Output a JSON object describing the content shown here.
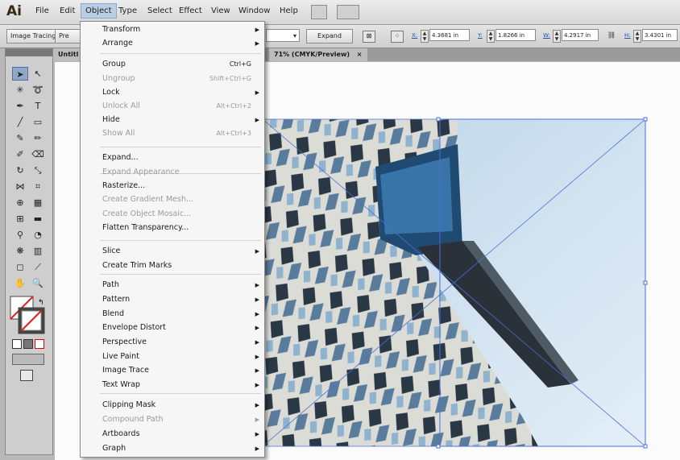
{
  "app": {
    "logo": "Ai"
  },
  "menubar": {
    "items": [
      "File",
      "Edit",
      "Object",
      "Type",
      "Select",
      "Effect",
      "View",
      "Window",
      "Help"
    ],
    "active": "Object"
  },
  "controlbar": {
    "image_tracing": "Image Tracing",
    "preset_short": "Pre",
    "expand": "Expand",
    "x_label": "X:",
    "x_value": "4.3681 in",
    "y_label": "Y:",
    "y_value": "1.8266 in",
    "w_label": "W:",
    "w_value": "4.2917 in",
    "h_label": "H:",
    "h_value": "3.4301 in"
  },
  "document_tab": {
    "title_prefix": "Untitl",
    "title_suffix": "71% (CMYK/Preview)",
    "close": "×"
  },
  "object_menu": {
    "items": [
      {
        "label": "Transform",
        "submenu": true
      },
      {
        "label": "Arrange",
        "submenu": true
      },
      {
        "label": "Group",
        "shortcut": "Ctrl+G"
      },
      {
        "label": "Ungroup",
        "shortcut": "Shift+Ctrl+G",
        "disabled": true
      },
      {
        "label": "Lock",
        "submenu": true
      },
      {
        "label": "Unlock All",
        "shortcut": "Alt+Ctrl+2",
        "disabled": true
      },
      {
        "label": "Hide",
        "submenu": true
      },
      {
        "label": "Show All",
        "shortcut": "Alt+Ctrl+3",
        "disabled": true
      },
      {
        "label": "Expand..."
      },
      {
        "label": "Expand Appearance",
        "disabled": true
      },
      {
        "label": "Rasterize..."
      },
      {
        "label": "Create Gradient Mesh...",
        "disabled": true
      },
      {
        "label": "Create Object Mosaic...",
        "disabled": true
      },
      {
        "label": "Flatten Transparency..."
      },
      {
        "label": "Slice",
        "submenu": true
      },
      {
        "label": "Create Trim Marks"
      },
      {
        "label": "Path",
        "submenu": true
      },
      {
        "label": "Pattern",
        "submenu": true
      },
      {
        "label": "Blend",
        "submenu": true
      },
      {
        "label": "Envelope Distort",
        "submenu": true
      },
      {
        "label": "Perspective",
        "submenu": true
      },
      {
        "label": "Live Paint",
        "submenu": true
      },
      {
        "label": "Image Trace",
        "submenu": true
      },
      {
        "label": "Text Wrap",
        "submenu": true
      },
      {
        "label": "Clipping Mask",
        "submenu": true
      },
      {
        "label": "Compound Path",
        "submenu": true,
        "disabled": true
      },
      {
        "label": "Artboards",
        "submenu": true
      },
      {
        "label": "Graph",
        "submenu": true
      }
    ]
  },
  "colors": {
    "selection": "#4a6fd8",
    "sky": "#c9dff0",
    "menu_highlight": "#b9cde3"
  }
}
